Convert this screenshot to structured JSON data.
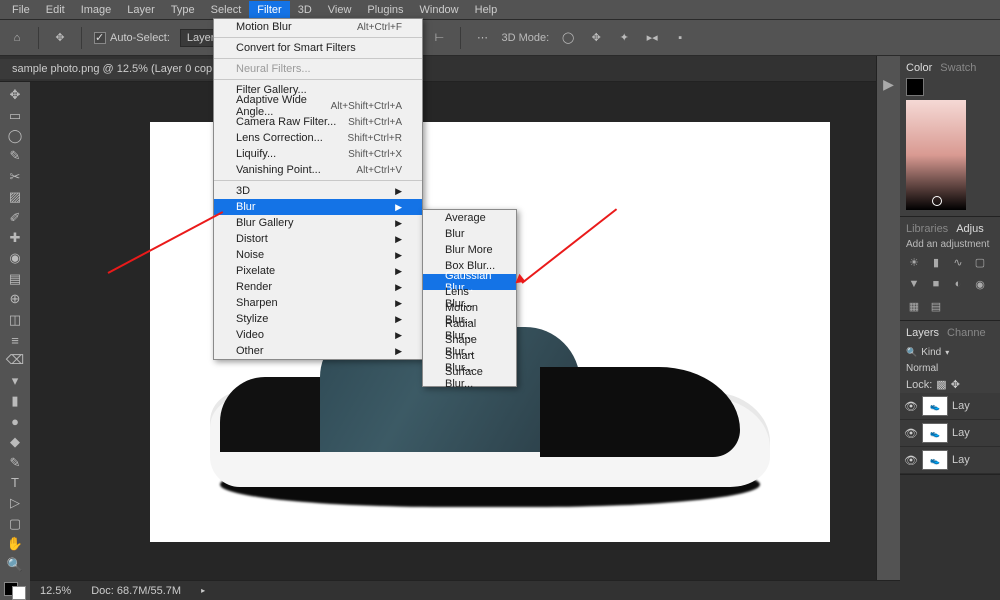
{
  "menubar": [
    "File",
    "Edit",
    "Image",
    "Layer",
    "Type",
    "Select",
    "Filter",
    "3D",
    "View",
    "Plugins",
    "Window",
    "Help"
  ],
  "activeMenu": "Filter",
  "optbar": {
    "autoSelect": "Auto-Select:",
    "layerDrop": "Layer"
  },
  "tab": "sample photo.png @ 12.5% (Layer 0 cop",
  "filterMenu": {
    "last": "Motion Blur",
    "lastShortcut": "Alt+Ctrl+F",
    "smart": "Convert for Smart Filters",
    "neural": "Neural Filters...",
    "group1": [
      {
        "label": "Filter Gallery...",
        "sc": ""
      },
      {
        "label": "Adaptive Wide Angle...",
        "sc": "Alt+Shift+Ctrl+A"
      },
      {
        "label": "Camera Raw Filter...",
        "sc": "Shift+Ctrl+A"
      },
      {
        "label": "Lens Correction...",
        "sc": "Shift+Ctrl+R"
      },
      {
        "label": "Liquify...",
        "sc": "Shift+Ctrl+X"
      },
      {
        "label": "Vanishing Point...",
        "sc": "Alt+Ctrl+V"
      }
    ],
    "group2": [
      "3D",
      "Blur",
      "Blur Gallery",
      "Distort",
      "Noise",
      "Pixelate",
      "Render",
      "Sharpen",
      "Stylize",
      "Video",
      "Other"
    ],
    "highlighted": "Blur"
  },
  "blurSubmenu": [
    "Average",
    "Blur",
    "Blur More",
    "Box Blur...",
    "Gaussian Blur...",
    "Lens Blur...",
    "Motion Blur...",
    "Radial Blur...",
    "Shape Blur...",
    "Smart Blur...",
    "Surface Blur..."
  ],
  "blurHighlighted": "Gaussian Blur...",
  "right": {
    "colorTab": "Color",
    "swatchTab": "Swatch",
    "libTab": "Libraries",
    "adjTab": "Adjus",
    "adjText": "Add an adjustment",
    "layersTab": "Layers",
    "channelsTab": "Channe",
    "kind": "Kind",
    "blend": "Normal",
    "lock": "Lock:",
    "layers": [
      {
        "name": "Lay"
      },
      {
        "name": "Lay"
      },
      {
        "name": "Lay"
      }
    ]
  },
  "status": {
    "zoom": "12.5%",
    "doc": "Doc: 68.7M/55.7M"
  }
}
